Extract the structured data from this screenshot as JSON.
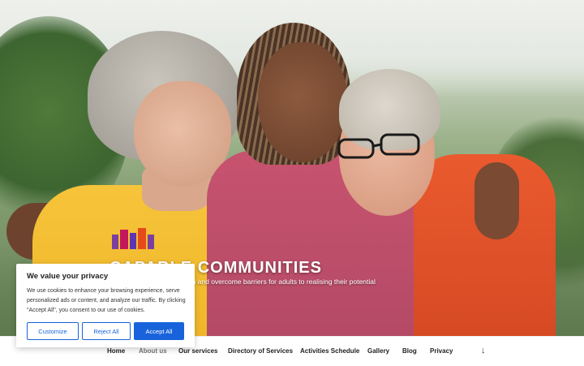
{
  "hero": {
    "site_title": "CAPABLE COMMUNITIES",
    "tagline": "…t to reduce social isolation and overcome barriers for adults to realising their potential",
    "shirt_logo_text": "CAPABLE\nCOMMUNITIES"
  },
  "nav": {
    "items": [
      {
        "label": "Home",
        "state": "active"
      },
      {
        "label": "About us",
        "state": "muted"
      },
      {
        "label": "Our services"
      },
      {
        "label": "Directory of Services"
      },
      {
        "label": "Activities Schedule"
      },
      {
        "label": "Gallery"
      },
      {
        "label": "Blog"
      },
      {
        "label": "Privacy"
      }
    ],
    "scroll_icon": "arrow-down-icon"
  },
  "cookie": {
    "title": "We value your privacy",
    "text": "We use cookies to enhance your browsing experience, serve personalized ads or content, and analyze our traffic. By clicking \"Accept All\", you consent to our use of cookies.",
    "customize_label": "Customize",
    "reject_label": "Reject All",
    "accept_label": "Accept All"
  },
  "colors": {
    "accent": "#1863dc",
    "shirt_yellow": "#f6c43a",
    "shirt_pink": "#c7536f",
    "jacket_orange": "#ea5a2e"
  }
}
